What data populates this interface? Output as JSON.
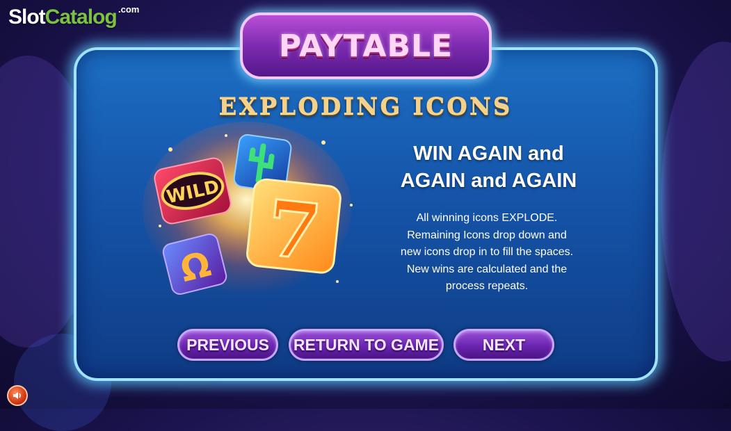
{
  "watermark": {
    "brand_part1": "Slot",
    "brand_part2": "Catalog",
    "suffix": ".com"
  },
  "header": {
    "title": "PAYTABLE"
  },
  "section": {
    "title": "EXPLODING ICONS"
  },
  "content": {
    "headline_line1": "WIN AGAIN and",
    "headline_line2": "AGAIN and AGAIN",
    "body_lines": [
      "All winning icons EXPLODE.",
      "Remaining Icons drop down and",
      "new icons drop in to fill the spaces.",
      "New wins are calculated and the",
      "process repeats."
    ],
    "art_symbols": {
      "wild": "WILD",
      "seven": "7",
      "horseshoe": "Ω"
    }
  },
  "buttons": {
    "previous": "PREVIOUS",
    "return": "RETURN TO GAME",
    "next": "NEXT"
  },
  "icons": {
    "sound": "speaker-icon"
  },
  "colors": {
    "panel_border": "#9fe3ff",
    "button_fill": "#6a24b0",
    "title_gold": "#f4d089",
    "brand_green": "#7cc242"
  }
}
